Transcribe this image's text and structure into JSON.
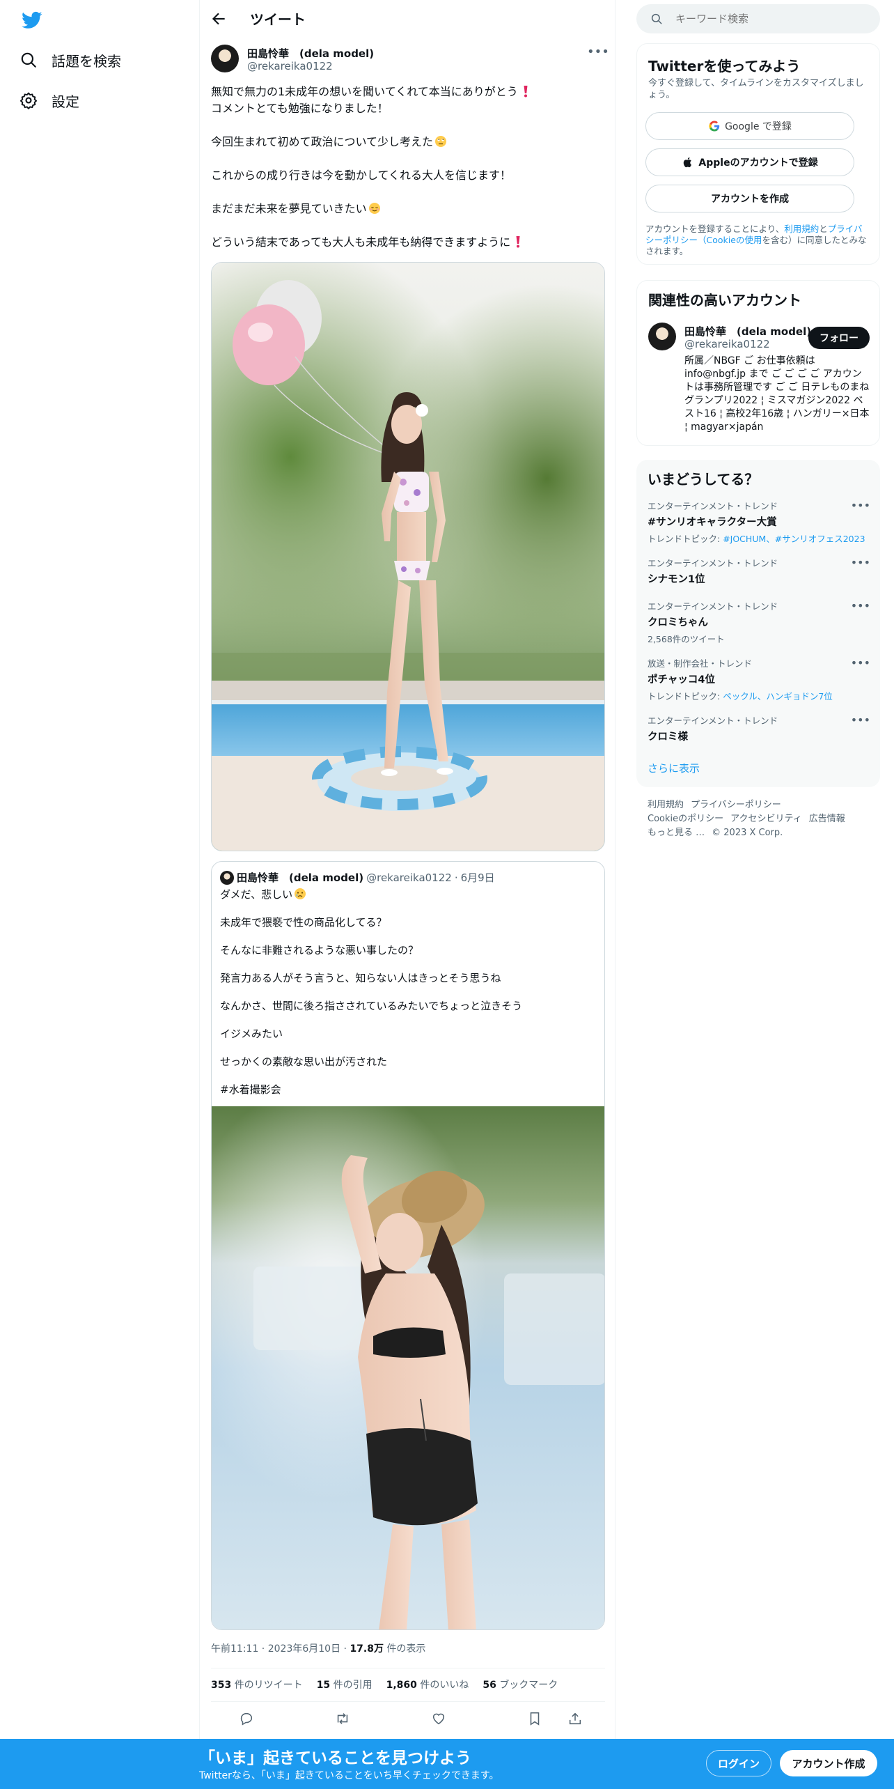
{
  "nav": {
    "explore_label": "話題を検索",
    "settings_label": "設定"
  },
  "header": {
    "title": "ツイート"
  },
  "tweet": {
    "author_name": "田島怜華　(dela model)",
    "author_handle": "@rekareika0122",
    "paragraphs": [
      "無知で無力の1未成年の想いを聞いてくれて本当にありがとう",
      "コメントとても勉強になりました！",
      "今回生まれて初めて政治について少し考えた",
      "これからの成り行きは今を動かしてくれる大人を信じます！",
      "まだまだ未来を夢見ていきたい",
      "どういう結末であっても大人も未成年も納得できますように"
    ],
    "time": "午前11:11",
    "date": "2023年6月10日",
    "views_count": "17.8万",
    "views_label": "件の表示",
    "retweets_count": "353",
    "retweets_label": "件のリツイート",
    "quotes_count": "15",
    "quotes_label": "件の引用",
    "likes_count": "1,860",
    "likes_label": "件のいいね",
    "bookmarks_count": "56",
    "bookmarks_label": "ブックマーク"
  },
  "quote": {
    "author_name": "田島怜華　(dela model)",
    "author_handle": "@rekareika0122",
    "date": "6月9日",
    "paragraphs": [
      "ダメだ、悲しい",
      "未成年で猥褻で性の商品化してる？",
      "そんなに非難されるような悪い事したの？",
      "発言力ある人がそう言うと、知らない人はきっとそう思うね",
      "なんかさ、世間に後ろ指さされているみたいでちょっと泣きそう",
      "イジメみたい",
      "せっかくの素敵な思い出が汚された",
      "#水着撮影会"
    ]
  },
  "search": {
    "placeholder": "キーワード検索"
  },
  "signup": {
    "title": "Twitterを使ってみよう",
    "subtitle": "今すぐ登録して、タイムラインをカスタマイズしましょう。",
    "google_label": "Google で登録",
    "apple_label": "Appleのアカウントで登録",
    "create_label": "アカウントを作成",
    "terms_prefix": "アカウントを登録することにより、",
    "terms_link": "利用規約",
    "terms_and": "と",
    "privacy_link": "プライバシーポリシー（Cookieの使用",
    "terms_suffix": "を含む）に同意したとみなされます。"
  },
  "related": {
    "title": "関連性の高いアカウント",
    "name": "田島怜華　(dela model)",
    "handle": "@rekareika0122",
    "follow_label": "フォロー",
    "bio": "所属／NBGF ご お仕事依頼は info@nbgf.jp まで ご ご ご ご アカウントは事務所管理です ご ご 日テレものまねグランプリ2022 ¦ ミスマガジン2022 ベスト16 ¦ 高校2年16歳 ¦ ハンガリー×日本 ¦ magyar×japán"
  },
  "trends": {
    "title": "いまどうしてる？",
    "items": [
      {
        "context": "エンターテインメント・トレンド",
        "name": "#サンリオキャラクター大賞",
        "sub_prefix": "トレンドトピック: ",
        "sub_links": "#JOCHUM、#サンリオフェス2023"
      },
      {
        "context": "エンターテインメント・トレンド",
        "name": "シナモン1位"
      },
      {
        "context": "エンターテインメント・トレンド",
        "name": "クロミちゃん",
        "sub_plain": "2,568件のツイート"
      },
      {
        "context": "放送・制作会社・トレンド",
        "name": "ポチャッコ4位",
        "sub_prefix": "トレンドトピック: ",
        "sub_links": "ペックル、ハンギョドン7位"
      },
      {
        "context": "エンターテインメント・トレンド",
        "name": "クロミ様"
      }
    ],
    "show_more": "さらに表示"
  },
  "footer": {
    "terms": "利用規約",
    "privacy": "プライバシーポリシー",
    "cookie": "Cookieのポリシー",
    "accessibility": "アクセシビリティ",
    "ads": "広告情報",
    "more": "もっと見る …",
    "copyright": "© 2023 X Corp."
  },
  "banner": {
    "title": "「いま」起きていることを見つけよう",
    "subtitle": "Twitterなら、「いま」起きていることをいち早くチェックできます。",
    "login_label": "ログイン",
    "signup_label": "アカウント作成"
  },
  "colors": {
    "accent": "#1d9bf0",
    "text": "#0f1419",
    "muted": "#536471",
    "border": "#eff3f4"
  },
  "icons": [
    "twitter-bird-icon",
    "search-icon",
    "gear-icon",
    "back-arrow-icon",
    "more-dots-icon",
    "reply-icon",
    "retweet-icon",
    "like-icon",
    "bookmark-icon",
    "share-icon",
    "google-icon",
    "apple-icon"
  ]
}
